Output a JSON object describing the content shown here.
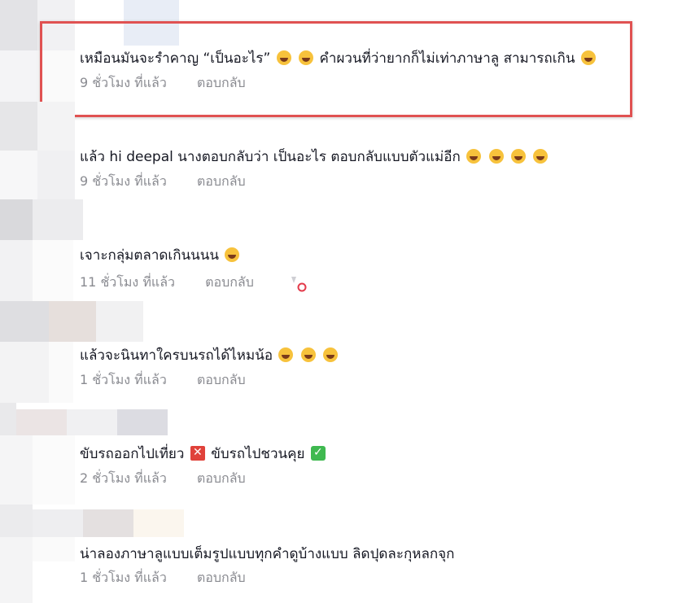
{
  "comments": [
    {
      "text": "เหมือนมันจะรำคาญ “เป็นอะไร”",
      "emoji_a": "sweat-smile",
      "emoji_b": "joy",
      "text_b": " คำผวนที่ว่ายากก็ไม่เท่าภาษาลู สามารถเกิน",
      "emoji_c": "grin",
      "time": "9 ชั่วโมง ที่แล้ว",
      "reply": "ตอบกลับ"
    },
    {
      "text": "แล้ว hi deepal นางตอบกลับว่า เป็นอะไร ตอบกลับแบบตัวแม่อีก",
      "emoji_names": [
        "rofl",
        "rofl",
        "rofl",
        "rofl"
      ],
      "time": "9 ชั่วโมง ที่แล้ว",
      "reply": "ตอบกลับ"
    },
    {
      "text": "เจาะกลุ่มตลาดเกินนนน",
      "emoji_names": [
        "joy"
      ],
      "time": "11 ชั่วโมง ที่แล้ว",
      "reply": "ตอบกลับ"
    },
    {
      "text": "แล้วจะนินทาใครบนรถได้ไหมน้อ",
      "emoji_names": [
        "joy",
        "joy",
        "joy"
      ],
      "time": "1 ชั่วโมง ที่แล้ว",
      "reply": "ตอบกลับ"
    },
    {
      "text": "ขับรถออกไปเที่ยว",
      "emoji_a": "cross-mark",
      "text_b": " ขับรถไปชวนคุย",
      "emoji_c": "check-mark",
      "time": "2 ชั่วโมง ที่แล้ว",
      "reply": "ตอบกลับ"
    },
    {
      "text": "น่าลองภาษาลูแบบเต็มรูปแบบทุกคำดูบ้างแบบ ลิดปุดละกุหลกจุก",
      "time": "1 ชั่วโมง ที่แล้ว",
      "reply": "ตอบกลับ"
    }
  ],
  "colors": {
    "highlight": "#e05252",
    "meta_text": "#8a8b91",
    "body_text": "#161823"
  }
}
